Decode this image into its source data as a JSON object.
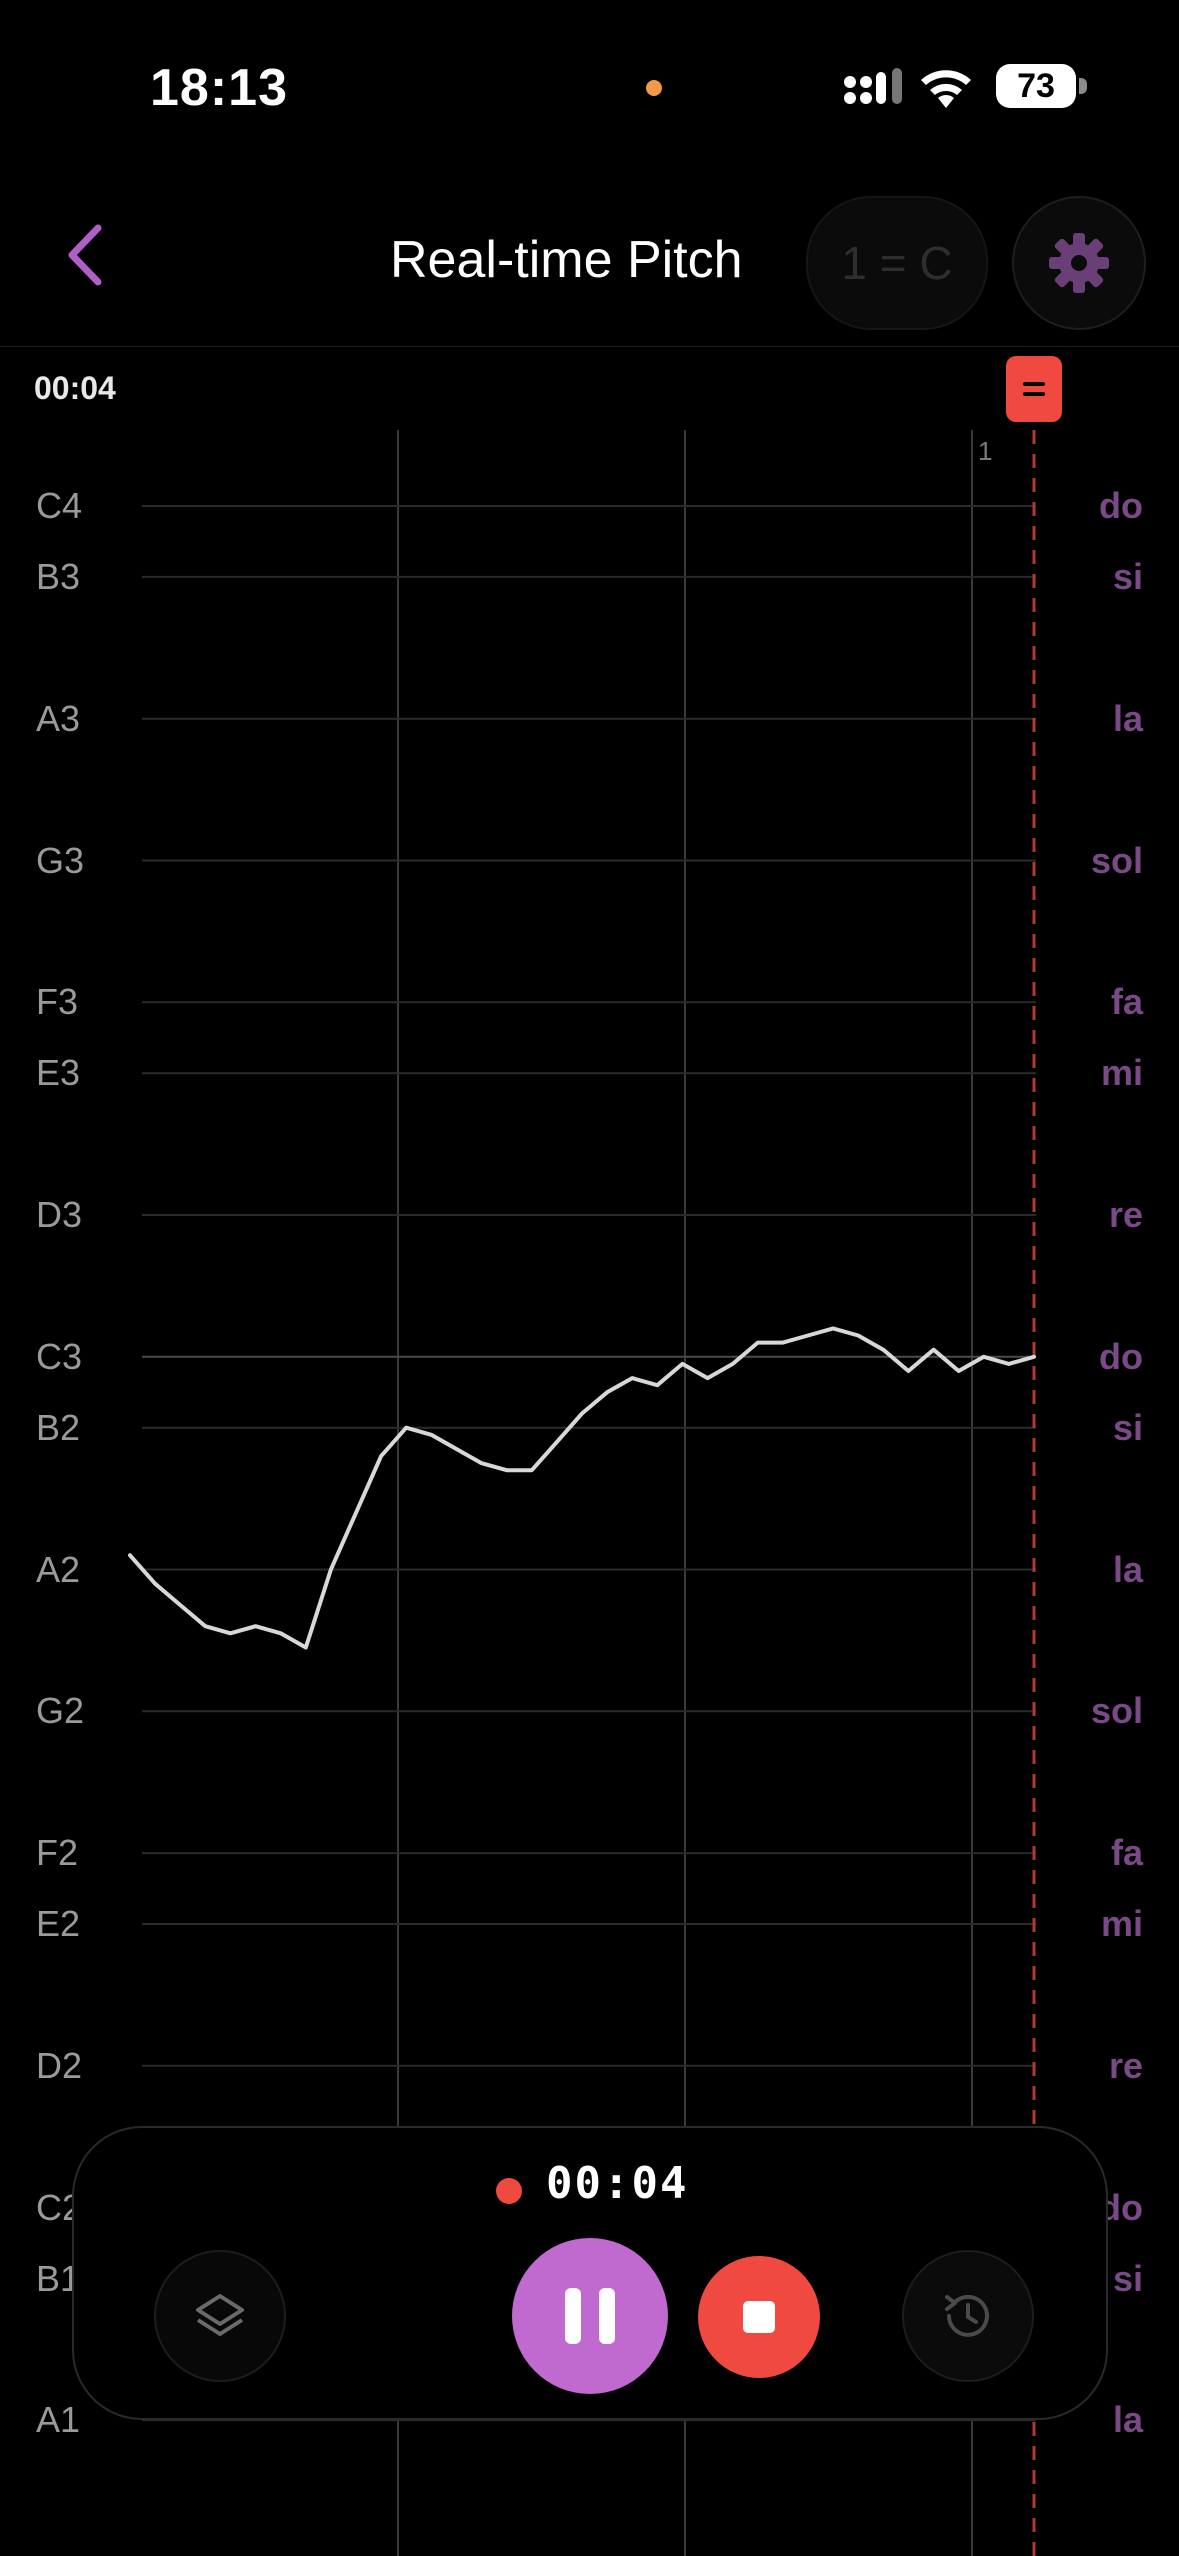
{
  "status_bar": {
    "time": "18:13",
    "battery": "73",
    "recording_indicator_color": "#f2994a"
  },
  "header": {
    "title": "Real-time Pitch",
    "key_label": "1 = C",
    "accent_color": "#b05fc8"
  },
  "elapsed": "00:04",
  "measure_label": "1",
  "notes": [
    {
      "name": "C4",
      "solfege": "do"
    },
    {
      "name": "B3",
      "solfege": "si"
    },
    {
      "name": "A3",
      "solfege": "la"
    },
    {
      "name": "G3",
      "solfege": "sol"
    },
    {
      "name": "F3",
      "solfege": "fa"
    },
    {
      "name": "E3",
      "solfege": "mi"
    },
    {
      "name": "D3",
      "solfege": "re"
    },
    {
      "name": "C3",
      "solfege": "do"
    },
    {
      "name": "B2",
      "solfege": "si"
    },
    {
      "name": "A2",
      "solfege": "la"
    },
    {
      "name": "G2",
      "solfege": "sol"
    },
    {
      "name": "F2",
      "solfege": "fa"
    },
    {
      "name": "E2",
      "solfege": "mi"
    },
    {
      "name": "D2",
      "solfege": "re"
    },
    {
      "name": "C2",
      "solfege": "do"
    },
    {
      "name": "B1",
      "solfege": "si"
    },
    {
      "name": "A1",
      "solfege": "la"
    }
  ],
  "pitch_trace_semitones_from_C3": [
    -2.8,
    -3.2,
    -3.5,
    -3.8,
    -3.9,
    -3.8,
    -3.9,
    -4.1,
    -3.0,
    -2.2,
    -1.4,
    -1.0,
    -1.1,
    -1.3,
    -1.5,
    -1.6,
    -1.6,
    -1.2,
    -0.8,
    -0.5,
    -0.3,
    -0.4,
    -0.1,
    -0.3,
    -0.1,
    0.2,
    0.2,
    0.3,
    0.4,
    0.3,
    0.1,
    -0.2,
    0.1,
    -0.2,
    0,
    -0.1,
    0
  ],
  "controls": {
    "recording_time": "00:04",
    "stop_color": "#f04a40",
    "pause_color": "#c06ad0"
  }
}
